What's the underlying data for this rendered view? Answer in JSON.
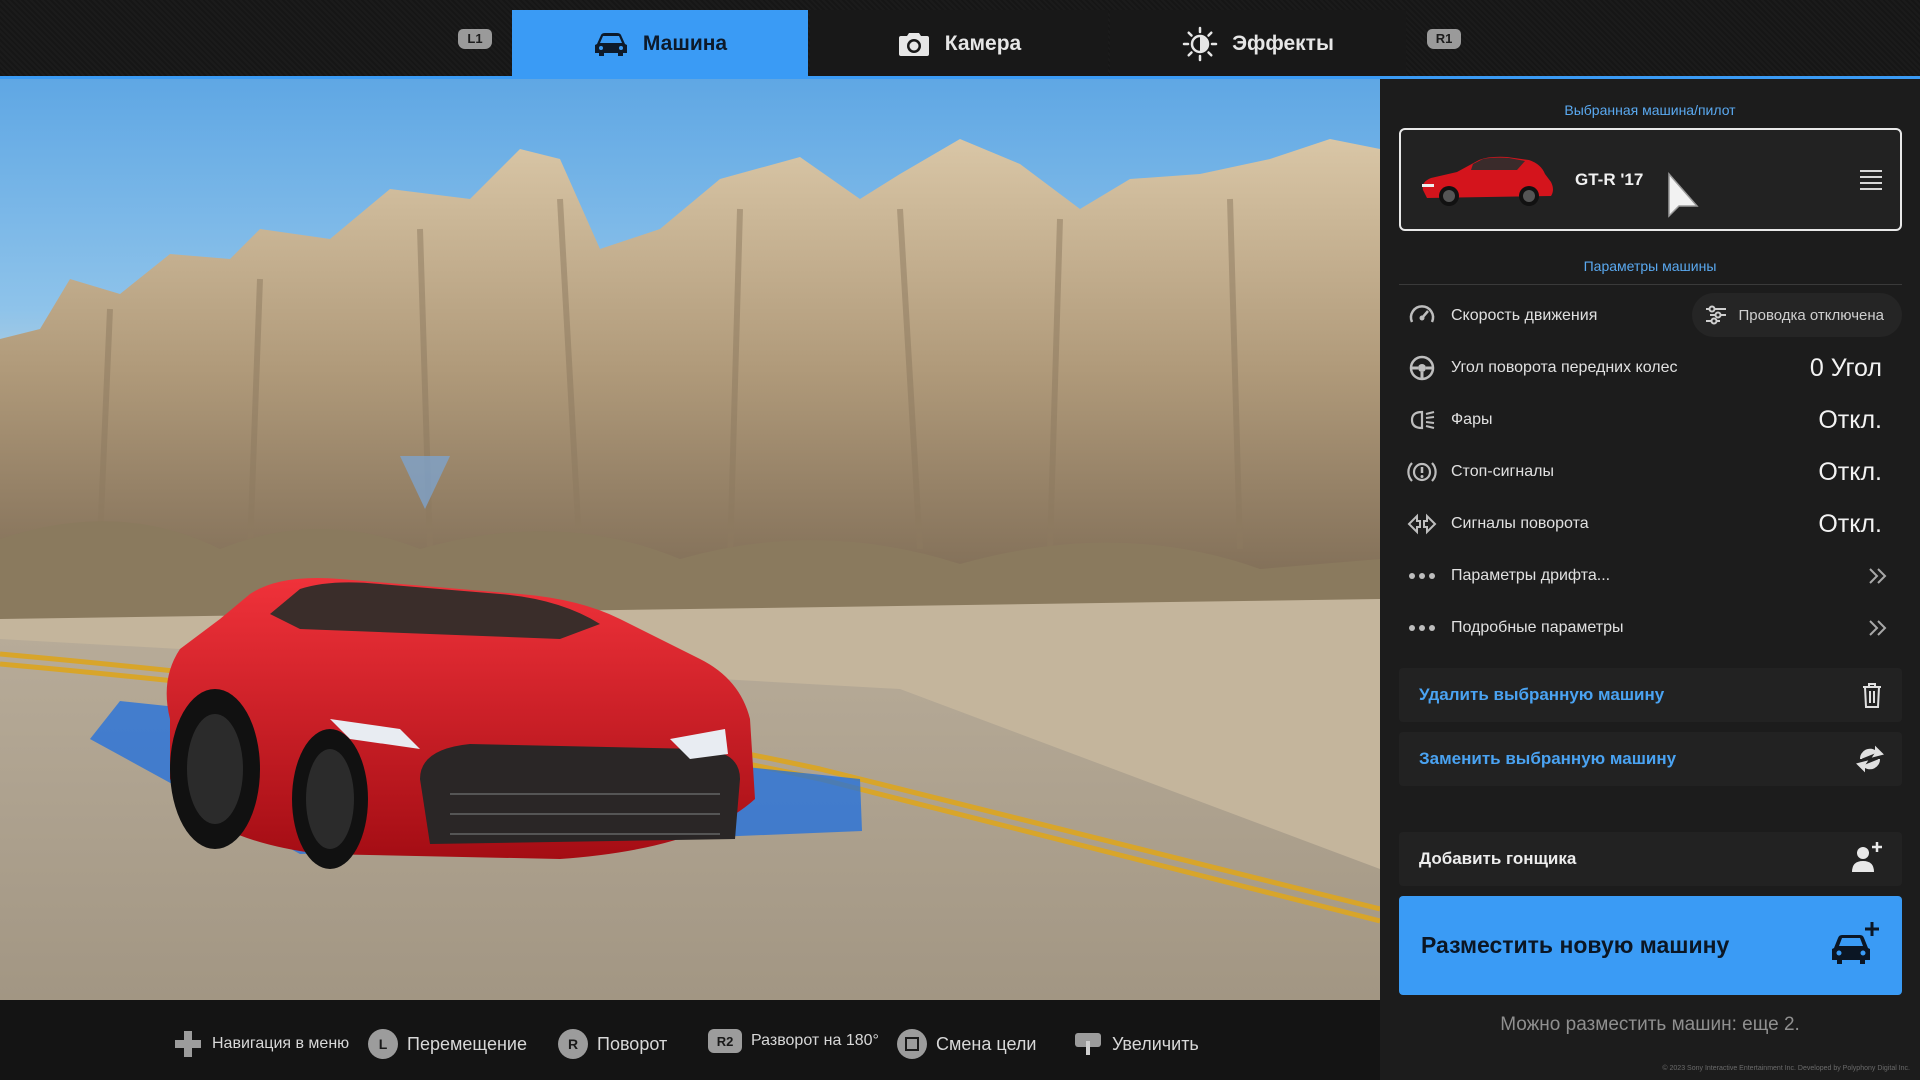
{
  "tabs": {
    "l1": "L1",
    "r1": "R1",
    "items": [
      {
        "label": "Машина",
        "icon": "car-icon",
        "active": true
      },
      {
        "label": "Камера",
        "icon": "camera-icon",
        "active": false
      },
      {
        "label": "Эффекты",
        "icon": "brightness-icon",
        "active": false
      }
    ]
  },
  "panel": {
    "selected_title": "Выбранная машина/пилот",
    "selected_car": {
      "name": "GT-R '17",
      "color": "#d4141c"
    },
    "params_title": "Параметры машины",
    "params": [
      {
        "label": "Скорость движения",
        "icon": "speedometer-icon",
        "button": "Проводка отключена",
        "button_icon": "wiring-icon"
      },
      {
        "label": "Угол поворота передних колес",
        "icon": "steering-wheel-icon",
        "value": "0 Угол"
      },
      {
        "label": "Фары",
        "icon": "headlight-icon",
        "value": "Откл."
      },
      {
        "label": "Стоп-сигналы",
        "icon": "brake-light-icon",
        "value": "Откл."
      },
      {
        "label": "Сигналы поворота",
        "icon": "turn-signal-icon",
        "value": "Откл."
      },
      {
        "label": "Параметры дрифта...",
        "icon": "more-dots-icon",
        "arrow": "»"
      },
      {
        "label": "Подробные параметры",
        "icon": "more-dots-icon",
        "arrow": "»"
      }
    ],
    "delete_label": "Удалить выбранную машину",
    "replace_label": "Заменить выбранную машину",
    "add_racer_label": "Добавить гонщика",
    "place_label": "Разместить новую машину",
    "remaining": "Можно разместить машин: еще 2.",
    "copyright": "© 2023 Sony Interactive Entertainment Inc. Developed by Polyphony Digital Inc."
  },
  "hints": [
    {
      "button": "",
      "label": "Навигация в меню",
      "icon": "dpad-icon"
    },
    {
      "button": "L",
      "label": "Перемещение",
      "icon": "left-stick-icon"
    },
    {
      "button": "R",
      "label": "Поворот",
      "icon": "right-stick-icon"
    },
    {
      "button": "R2",
      "label": "Разворот на 180°",
      "icon": "r2-icon"
    },
    {
      "button": "",
      "label": "Смена цели",
      "icon": "square-button-icon"
    },
    {
      "button": "",
      "label": "Увеличить",
      "icon": "touchpad-icon"
    }
  ],
  "colors": {
    "accent": "#3a9bf5",
    "panel_bg": "#1c1c1c",
    "car_red": "#d4141c"
  }
}
